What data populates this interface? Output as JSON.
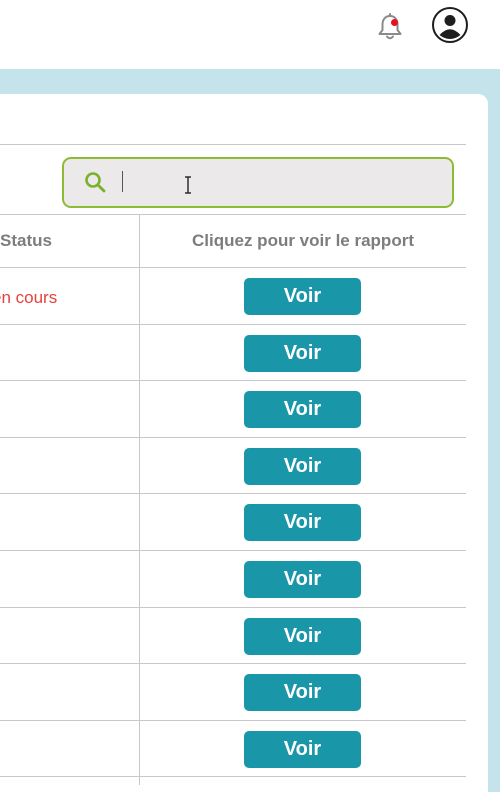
{
  "header": {
    "notifications": {
      "icon": "bell-icon",
      "badge_color": "#e8121a"
    },
    "account": {
      "icon": "user-avatar-icon"
    }
  },
  "search": {
    "icon": "search-icon",
    "value": "",
    "accent_color": "#8dbb34"
  },
  "table": {
    "columns": [
      "Status",
      "Cliquez pour voir le rapport"
    ],
    "rows": [
      {
        "status": "en cours",
        "action_label": "Voir"
      },
      {
        "status": "",
        "action_label": "Voir"
      },
      {
        "status": "",
        "action_label": "Voir"
      },
      {
        "status": "",
        "action_label": "Voir"
      },
      {
        "status": "",
        "action_label": "Voir"
      },
      {
        "status": "",
        "action_label": "Voir"
      },
      {
        "status": "",
        "action_label": "Voir"
      },
      {
        "status": "",
        "action_label": "Voir"
      },
      {
        "status": "",
        "action_label": "Voir"
      }
    ]
  },
  "colors": {
    "band_background": "#c4e3ea",
    "button_background": "#1a96a9",
    "status_color": "#e5413d"
  }
}
